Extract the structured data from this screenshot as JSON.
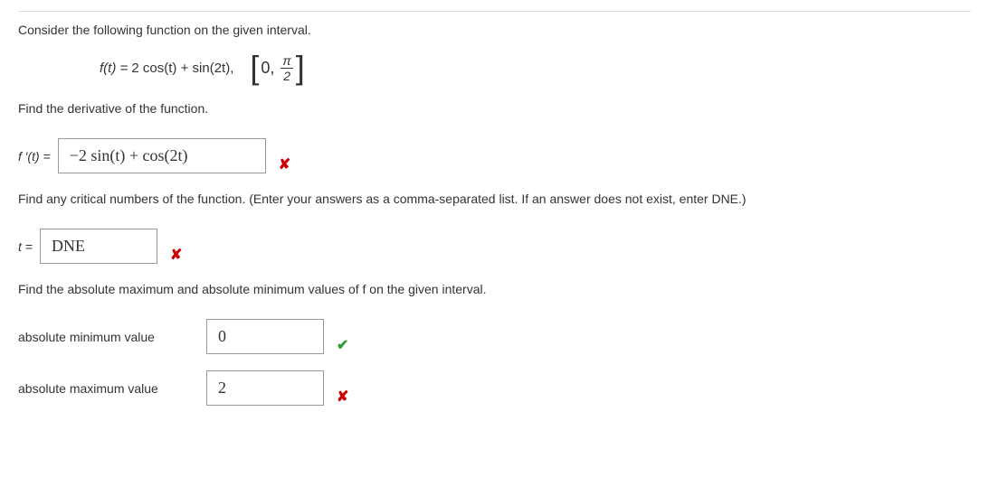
{
  "q1": {
    "intro": "Consider the following function on the given interval.",
    "function_lhs": "f(t) = ",
    "function_rhs": "2 cos(t) + sin(2t),",
    "interval_zero": "0,",
    "interval_pi": "π",
    "interval_den": "2"
  },
  "q2": {
    "prompt": "Find the derivative of the function.",
    "label_lhs": "f ′(t) = ",
    "answer": "−2 sin(t) + cos(2t)"
  },
  "q3": {
    "prompt": "Find any critical numbers of the function. (Enter your answers as a comma-separated list. If an answer does not exist, enter DNE.)",
    "label_lhs": "t = ",
    "answer": "DNE"
  },
  "q4": {
    "prompt": "Find the absolute maximum and absolute minimum values of f on the given interval.",
    "min_label": "absolute minimum value",
    "min_answer": "0",
    "max_label": "absolute maximum value",
    "max_answer": "2"
  },
  "icons": {
    "wrong": "✘",
    "correct": "✔"
  }
}
